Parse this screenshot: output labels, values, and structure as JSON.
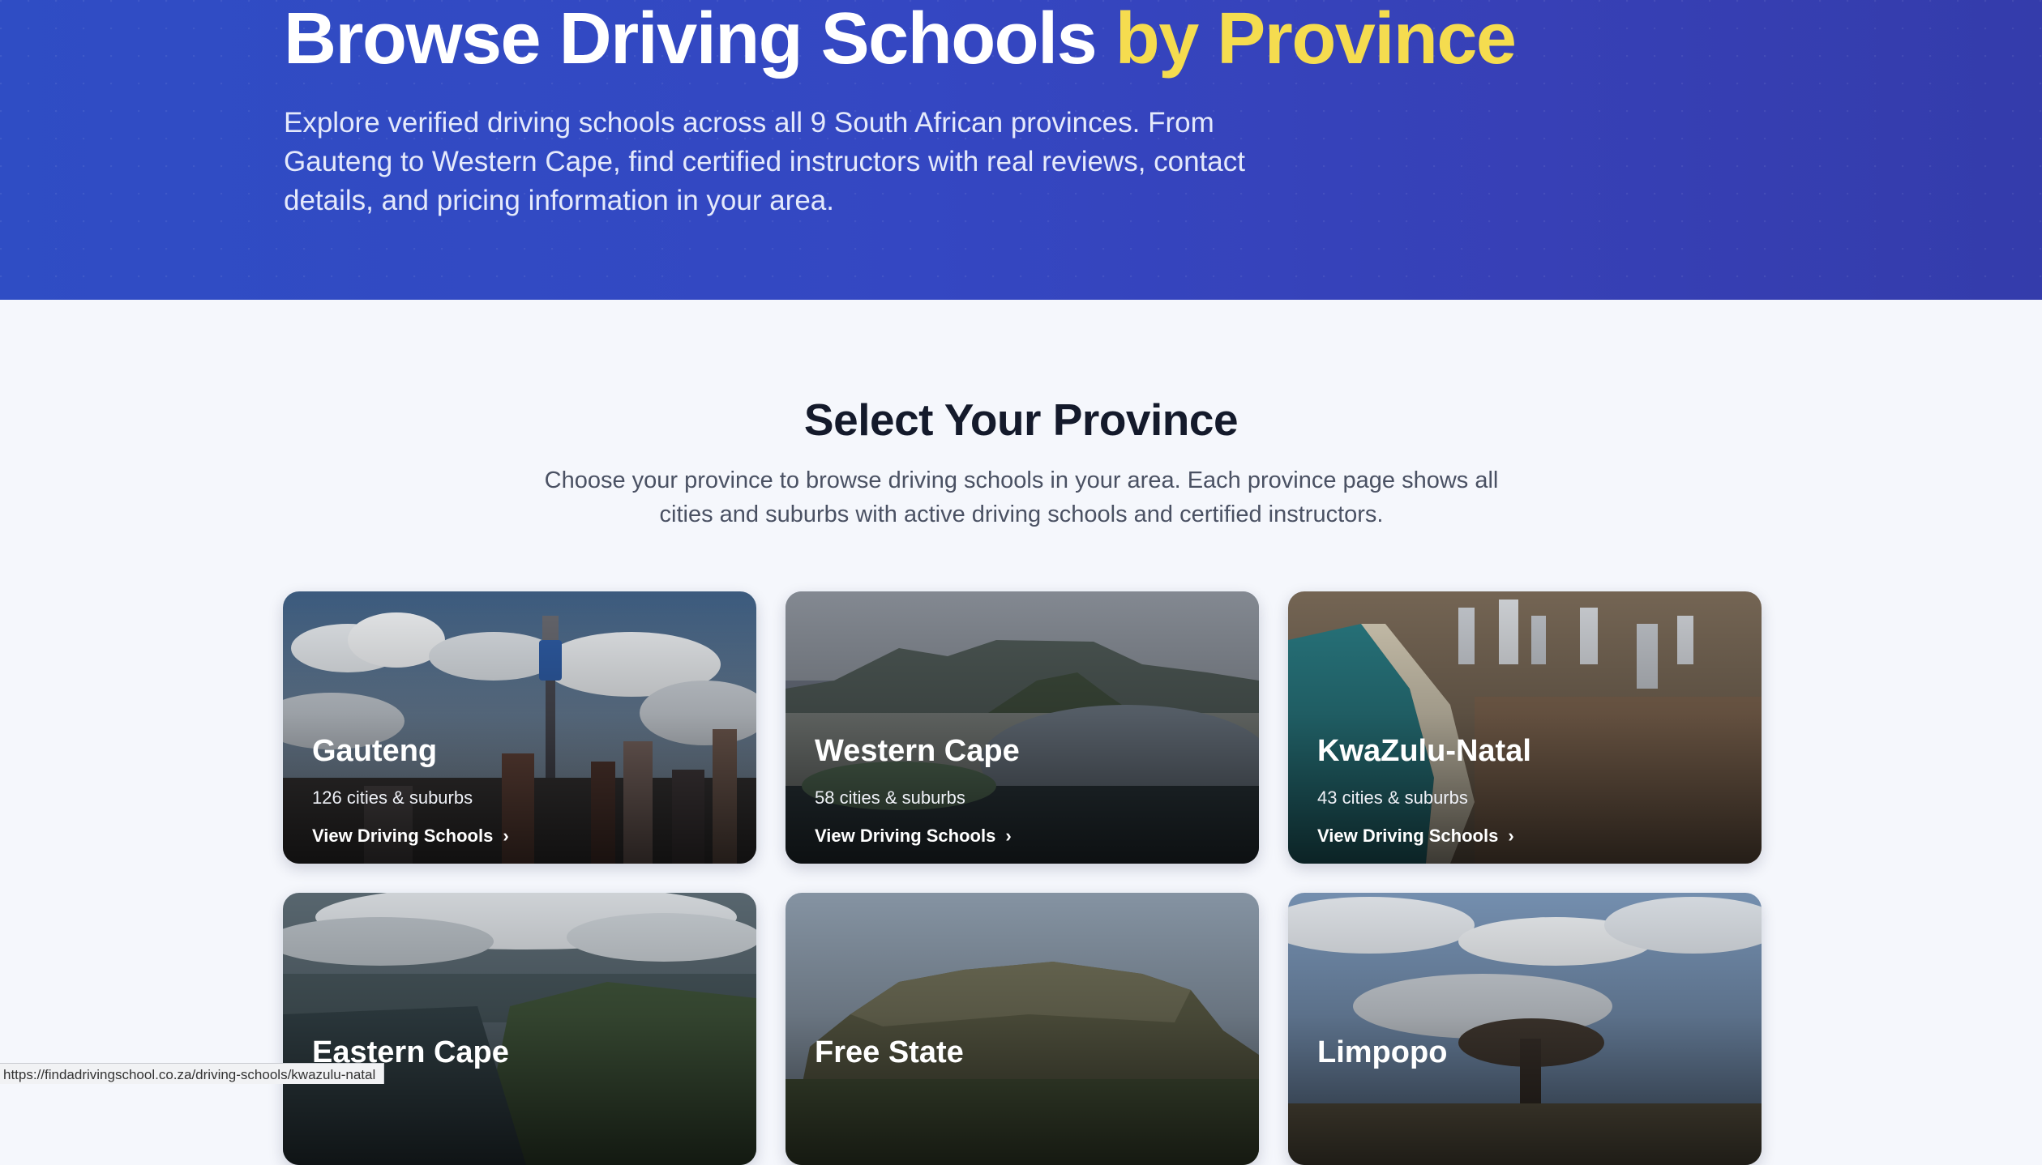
{
  "hero": {
    "title_main": "Browse Driving Schools ",
    "title_accent": "by Province",
    "description": "Explore verified driving schools across all 9 South African provinces. From Gauteng to Western Cape, find certified instructors with real reviews, contact details, and pricing information in your area."
  },
  "section": {
    "title": "Select Your Province",
    "description": "Choose your province to browse driving schools in your area. Each province page shows all cities and suburbs with active driving schools and certified instructors."
  },
  "provinces": [
    {
      "name": "Gauteng",
      "count": "126 cities & suburbs",
      "link": "View Driving Schools"
    },
    {
      "name": "Western Cape",
      "count": "58 cities & suburbs",
      "link": "View Driving Schools"
    },
    {
      "name": "KwaZulu-Natal",
      "count": "43 cities & suburbs",
      "link": "View Driving Schools"
    },
    {
      "name": "Eastern Cape",
      "count": "",
      "link": ""
    },
    {
      "name": "Free State",
      "count": "",
      "link": ""
    },
    {
      "name": "Limpopo",
      "count": "",
      "link": ""
    }
  ],
  "icons": {
    "chevron": "chevron-right-icon"
  },
  "colors": {
    "hero_bg": "#3447c2",
    "accent": "#f5dc4f",
    "page_bg": "#f5f7fc"
  },
  "status_bar": {
    "url": "https://findadrivingschool.co.za/driving-schools/kwazulu-natal"
  }
}
